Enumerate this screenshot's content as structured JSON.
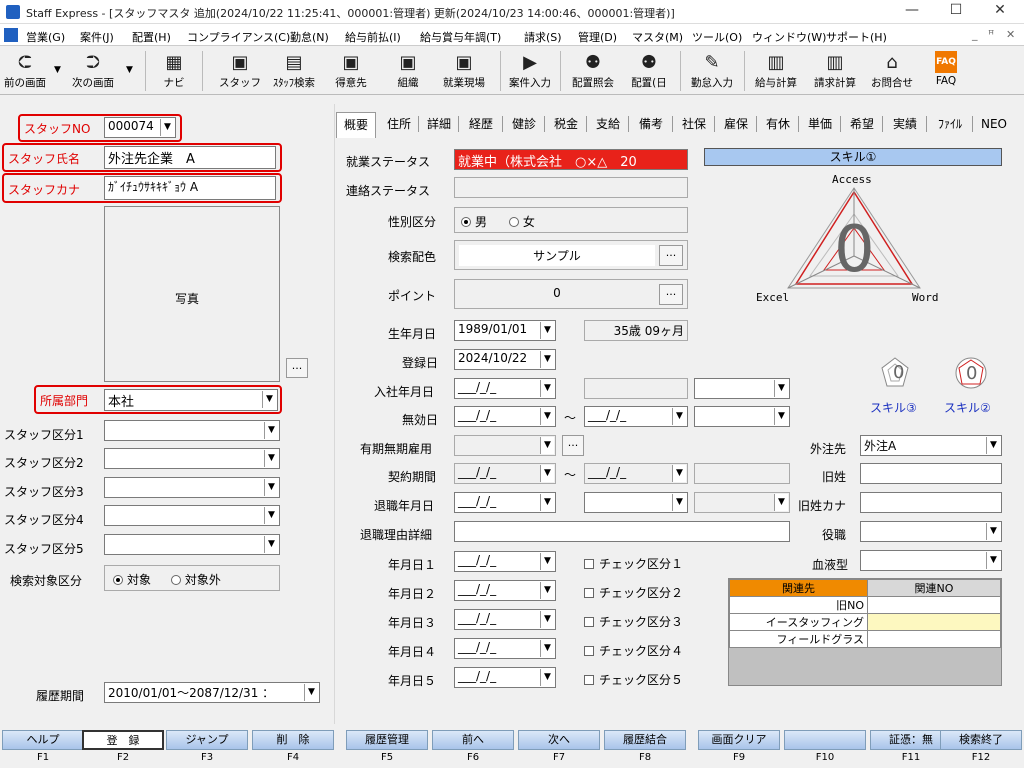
{
  "window": {
    "title": "Staff Express - [スタッフマスタ 追加(2024/10/22 11:25:41、000001:管理者) 更新(2024/10/23 14:00:46、000001:管理者)]",
    "minimize": "—",
    "maximize": "☐",
    "close": "✕"
  },
  "menu": [
    "営業(G)",
    "案件(J)",
    "配置(H)",
    "コンプライアンス(C)",
    "勤怠(N)",
    "給与前払(I)",
    "給与賞与年調(T)",
    "請求(S)",
    "管理(D)",
    "マスタ(M)",
    "ツール(O)",
    "ウィンドウ(W)",
    "サポート(H)"
  ],
  "mdi": {
    "min": "_",
    "restore": "ꟸ",
    "close": "✕"
  },
  "toolbar": [
    {
      "label": "前の画面",
      "icon": "arrow-left-icon"
    },
    {
      "label": "次の画面",
      "icon": "arrow-right-icon"
    },
    {
      "label": "ナビ",
      "icon": "navi-icon"
    },
    {
      "label": "スタッフ",
      "icon": "staff-icon"
    },
    {
      "label": "ｽﾀｯﾌ検索",
      "icon": "staff-search-icon"
    },
    {
      "label": "得意先",
      "icon": "client-icon"
    },
    {
      "label": "組織",
      "icon": "org-icon"
    },
    {
      "label": "就業現場",
      "icon": "worksite-icon"
    },
    {
      "label": "案件入力",
      "icon": "case-input-icon"
    },
    {
      "label": "配置照会",
      "icon": "assign-query-icon"
    },
    {
      "label": "配置(日",
      "icon": "assign-day-icon"
    },
    {
      "label": "勤怠入力",
      "icon": "attendance-icon"
    },
    {
      "label": "給与計算",
      "icon": "payroll-icon"
    },
    {
      "label": "請求計算",
      "icon": "billing-icon"
    },
    {
      "label": "お問合せ",
      "icon": "inquiry-icon"
    },
    {
      "label": "FAQ",
      "icon": "faq-icon"
    }
  ],
  "left": {
    "staff_no_label": "スタッフNO",
    "staff_no": "000074",
    "staff_name_label": "スタッフ氏名",
    "staff_name": "外注先企業　A",
    "staff_kana_label": "スタッフカナ",
    "staff_kana": "ｶﾞｲﾁｭｳｻｷｷｷﾞｮｳ A",
    "photo_label": "写真",
    "photo_btn": "...",
    "dept_label": "所属部門",
    "dept": "本社",
    "kubun": [
      "スタッフ区分1",
      "スタッフ区分2",
      "スタッフ区分3",
      "スタッフ区分4",
      "スタッフ区分5"
    ],
    "search_target_label": "検索対象区分",
    "search_on": "対象",
    "search_off": "対象外",
    "history_label": "履歴期間",
    "history": "2010/01/01～2087/12/31 ："
  },
  "tabs": [
    "概要",
    "住所",
    "詳細",
    "経歴",
    "健診",
    "税金",
    "支給",
    "備考",
    "社保",
    "雇保",
    "有休",
    "単価",
    "希望",
    "実績",
    "ﾌｧｲﾙ",
    "NEO"
  ],
  "overview": {
    "work_status_label": "就業ステータス",
    "work_status": "就業中（株式会社　○×△　20",
    "contact_status_label": "連絡ステータス",
    "gender_label": "性別区分",
    "male": "男",
    "female": "女",
    "color_label": "検索配色",
    "color": "サンプル",
    "dots": "...",
    "point_label": "ポイント",
    "point": "0",
    "birth_label": "生年月日",
    "birth": "1989/01/01",
    "age": "35歳 09ヶ月",
    "reg_label": "登録日",
    "reg": "2024/10/22",
    "join_label": "入社年月日",
    "blank_date": "___/_/_",
    "tilde": "～",
    "invalid_label": "無効日",
    "fixed_label": "有期無期雇用",
    "contract_label": "契約期間",
    "retire_label": "退職年月日",
    "retire_reason_label": "退職理由詳細",
    "dates": [
      "年月日１",
      "年月日２",
      "年月日３",
      "年月日４",
      "年月日５"
    ],
    "checks": [
      "チェック区分１",
      "チェック区分２",
      "チェック区分３",
      "チェック区分４",
      "チェック区分５"
    ]
  },
  "right": {
    "skill1": "スキル①",
    "access": "Access",
    "excel": "Excel",
    "word": "Word",
    "radar_value": "0",
    "skill3": "スキル③",
    "skill2": "スキル②",
    "outsource_label": "外注先",
    "outsource": "外注A",
    "old_name_label": "旧姓",
    "old_kana_label": "旧姓カナ",
    "position_label": "役職",
    "blood_label": "血液型",
    "rel_head1": "関連先",
    "rel_head2": "関連NO",
    "rel_rows": [
      "旧NO",
      "イースタッフィング",
      "フィールドグラス"
    ]
  },
  "fkeys": [
    {
      "label": "ヘルプ",
      "key": "F1"
    },
    {
      "label": "登　録",
      "key": "F2"
    },
    {
      "label": "ジャンプ",
      "key": "F3"
    },
    {
      "label": "削　除",
      "key": "F4"
    },
    {
      "label": "履歴管理",
      "key": "F5"
    },
    {
      "label": "前へ",
      "key": "F6"
    },
    {
      "label": "次へ",
      "key": "F7"
    },
    {
      "label": "履歴結合",
      "key": "F8"
    },
    {
      "label": "画面クリア",
      "key": "F9"
    },
    {
      "label": "",
      "key": "F10"
    },
    {
      "label": "証憑：無",
      "key": "F11"
    },
    {
      "label": "検索終了",
      "key": "F12"
    }
  ],
  "colors": {
    "red": "#e00000",
    "work_status_bg": "#e8221a",
    "skill_header_bg": "#a8c8f0",
    "rel_head_orange": "#f08a00",
    "rel_yellow": "#fdf8c0"
  }
}
